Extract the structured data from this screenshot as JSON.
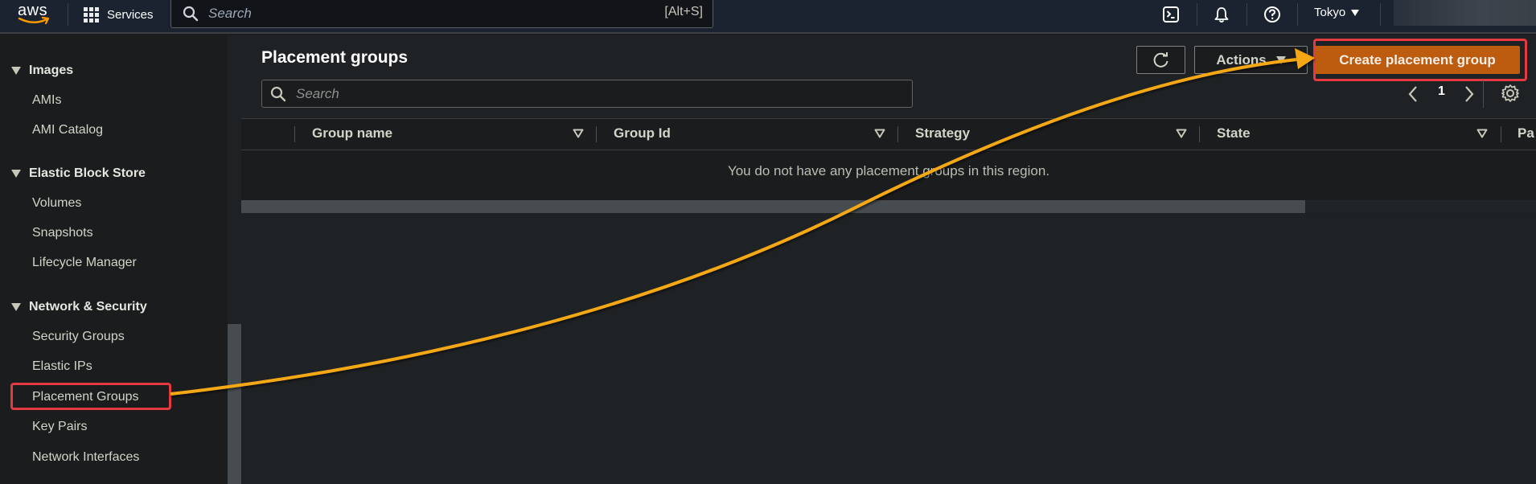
{
  "topnav": {
    "logo": "aws",
    "services_label": "Services",
    "search_placeholder": "Search",
    "search_shortcut": "[Alt+S]",
    "icons": [
      "cloudshell-icon",
      "bell-icon",
      "help-icon"
    ],
    "region_label": "Tokyo"
  },
  "sidebar": {
    "sections": [
      {
        "label": "Images",
        "items": [
          "AMIs",
          "AMI Catalog"
        ]
      },
      {
        "label": "Elastic Block Store",
        "items": [
          "Volumes",
          "Snapshots",
          "Lifecycle Manager"
        ]
      },
      {
        "label": "Network & Security",
        "items": [
          "Security Groups",
          "Elastic IPs",
          "Placement Groups",
          "Key Pairs",
          "Network Interfaces"
        ]
      }
    ],
    "highlighted_item": "Placement Groups"
  },
  "main": {
    "title": "Placement groups",
    "actions_label": "Actions",
    "create_label": "Create placement group",
    "filter_placeholder": "Search",
    "page_number": "1",
    "columns": [
      "Group name",
      "Group Id",
      "Strategy",
      "State",
      "Pa"
    ],
    "empty_message": "You do not have any placement groups in this region."
  },
  "annotation": {
    "arrow_color": "#f5a814",
    "highlight_color": "#e53a3f",
    "from": "Placement Groups",
    "to": "Create placement group"
  },
  "colors": {
    "primary_button": "#bd5b0e",
    "nav_background": "#1b2330"
  }
}
